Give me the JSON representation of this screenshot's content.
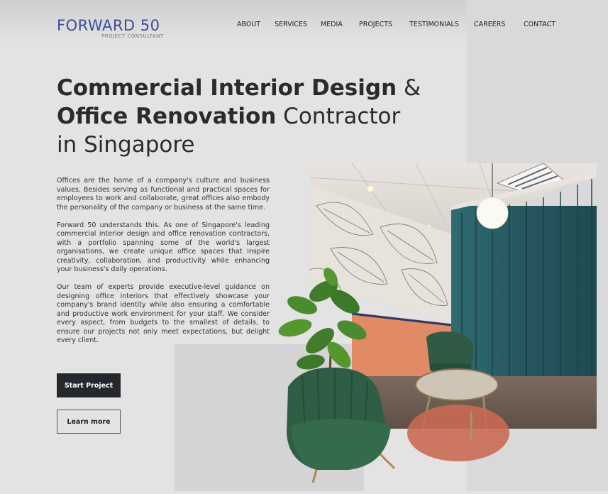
{
  "brand": {
    "name": "FORWARD 50",
    "tagline": "PROJECT CONSULTANT",
    "color": "#3d4e98"
  },
  "nav": [
    {
      "label": "ABOUT"
    },
    {
      "label": "SERVICES"
    },
    {
      "label": "MEDIA"
    },
    {
      "label": "PROJECTS"
    },
    {
      "label": "TESTIMONIALS"
    },
    {
      "label": "CAREERS"
    },
    {
      "label": "CONTACT"
    }
  ],
  "hero": {
    "line1_bold": "Commercial Interior Design",
    "line1_rest": " &",
    "line2_bold": "Office Renovation",
    "line2_rest": " Contractor",
    "line3": "in Singapore"
  },
  "paragraphs": [
    "Offices are the home of a company's culture and business values. Besides serving as functional and practical spaces for employees to work and collaborate, great offices also embody the personality of the company or business at the same time.",
    "Forward 50 understands this. As one of Singapore's leading commercial interior design and office renovation contractors, with a portfolio spanning some of the world's largest organisations, we create unique office spaces that inspire creativity, collaboration, and productivity while enhancing your business's daily operations.",
    "Our team of experts provide executive-level guidance on designing office interiors that effectively showcase your company's brand identity while also ensuring a comfortable and productive work environment for your staff. We consider every aspect, from budgets to the smallest of details, to ensure our projects not only meet expectations, but delight every client."
  ],
  "buttons": {
    "start": "Start Project",
    "learn": "Learn more"
  }
}
